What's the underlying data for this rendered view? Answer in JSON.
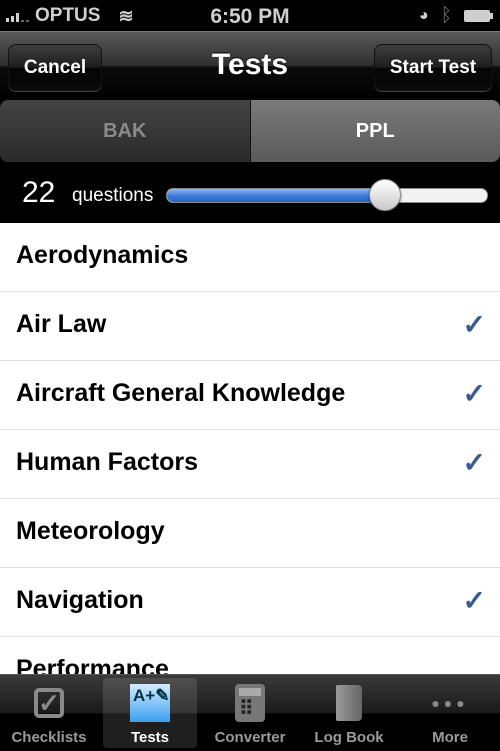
{
  "status": {
    "carrier": "OPTUS",
    "time": "6:50 PM"
  },
  "nav": {
    "title": "Tests",
    "left_button": "Cancel",
    "right_button": "Start Test"
  },
  "segments": [
    {
      "label": "BAK",
      "selected": false
    },
    {
      "label": "PPL",
      "selected": true
    }
  ],
  "questions": {
    "count": "22",
    "label": "questions",
    "slider_fraction": 0.68
  },
  "topics": [
    {
      "label": "Aerodynamics",
      "checked": false
    },
    {
      "label": "Air Law",
      "checked": true
    },
    {
      "label": "Aircraft General Knowledge",
      "checked": true
    },
    {
      "label": "Human Factors",
      "checked": true
    },
    {
      "label": "Meteorology",
      "checked": false
    },
    {
      "label": "Navigation",
      "checked": true
    },
    {
      "label": "Performance",
      "checked": false
    }
  ],
  "check_glyph": "✓",
  "tabs": [
    {
      "label": "Checklists",
      "icon": "checkbox-icon"
    },
    {
      "label": "Tests",
      "icon": "tests-icon",
      "active": true
    },
    {
      "label": "Converter",
      "icon": "calculator-icon"
    },
    {
      "label": "Log Book",
      "icon": "book-icon"
    },
    {
      "label": "More",
      "icon": "more-icon"
    }
  ],
  "colors": {
    "accent": "#3b5a8f",
    "slider": "#3c78d8"
  }
}
